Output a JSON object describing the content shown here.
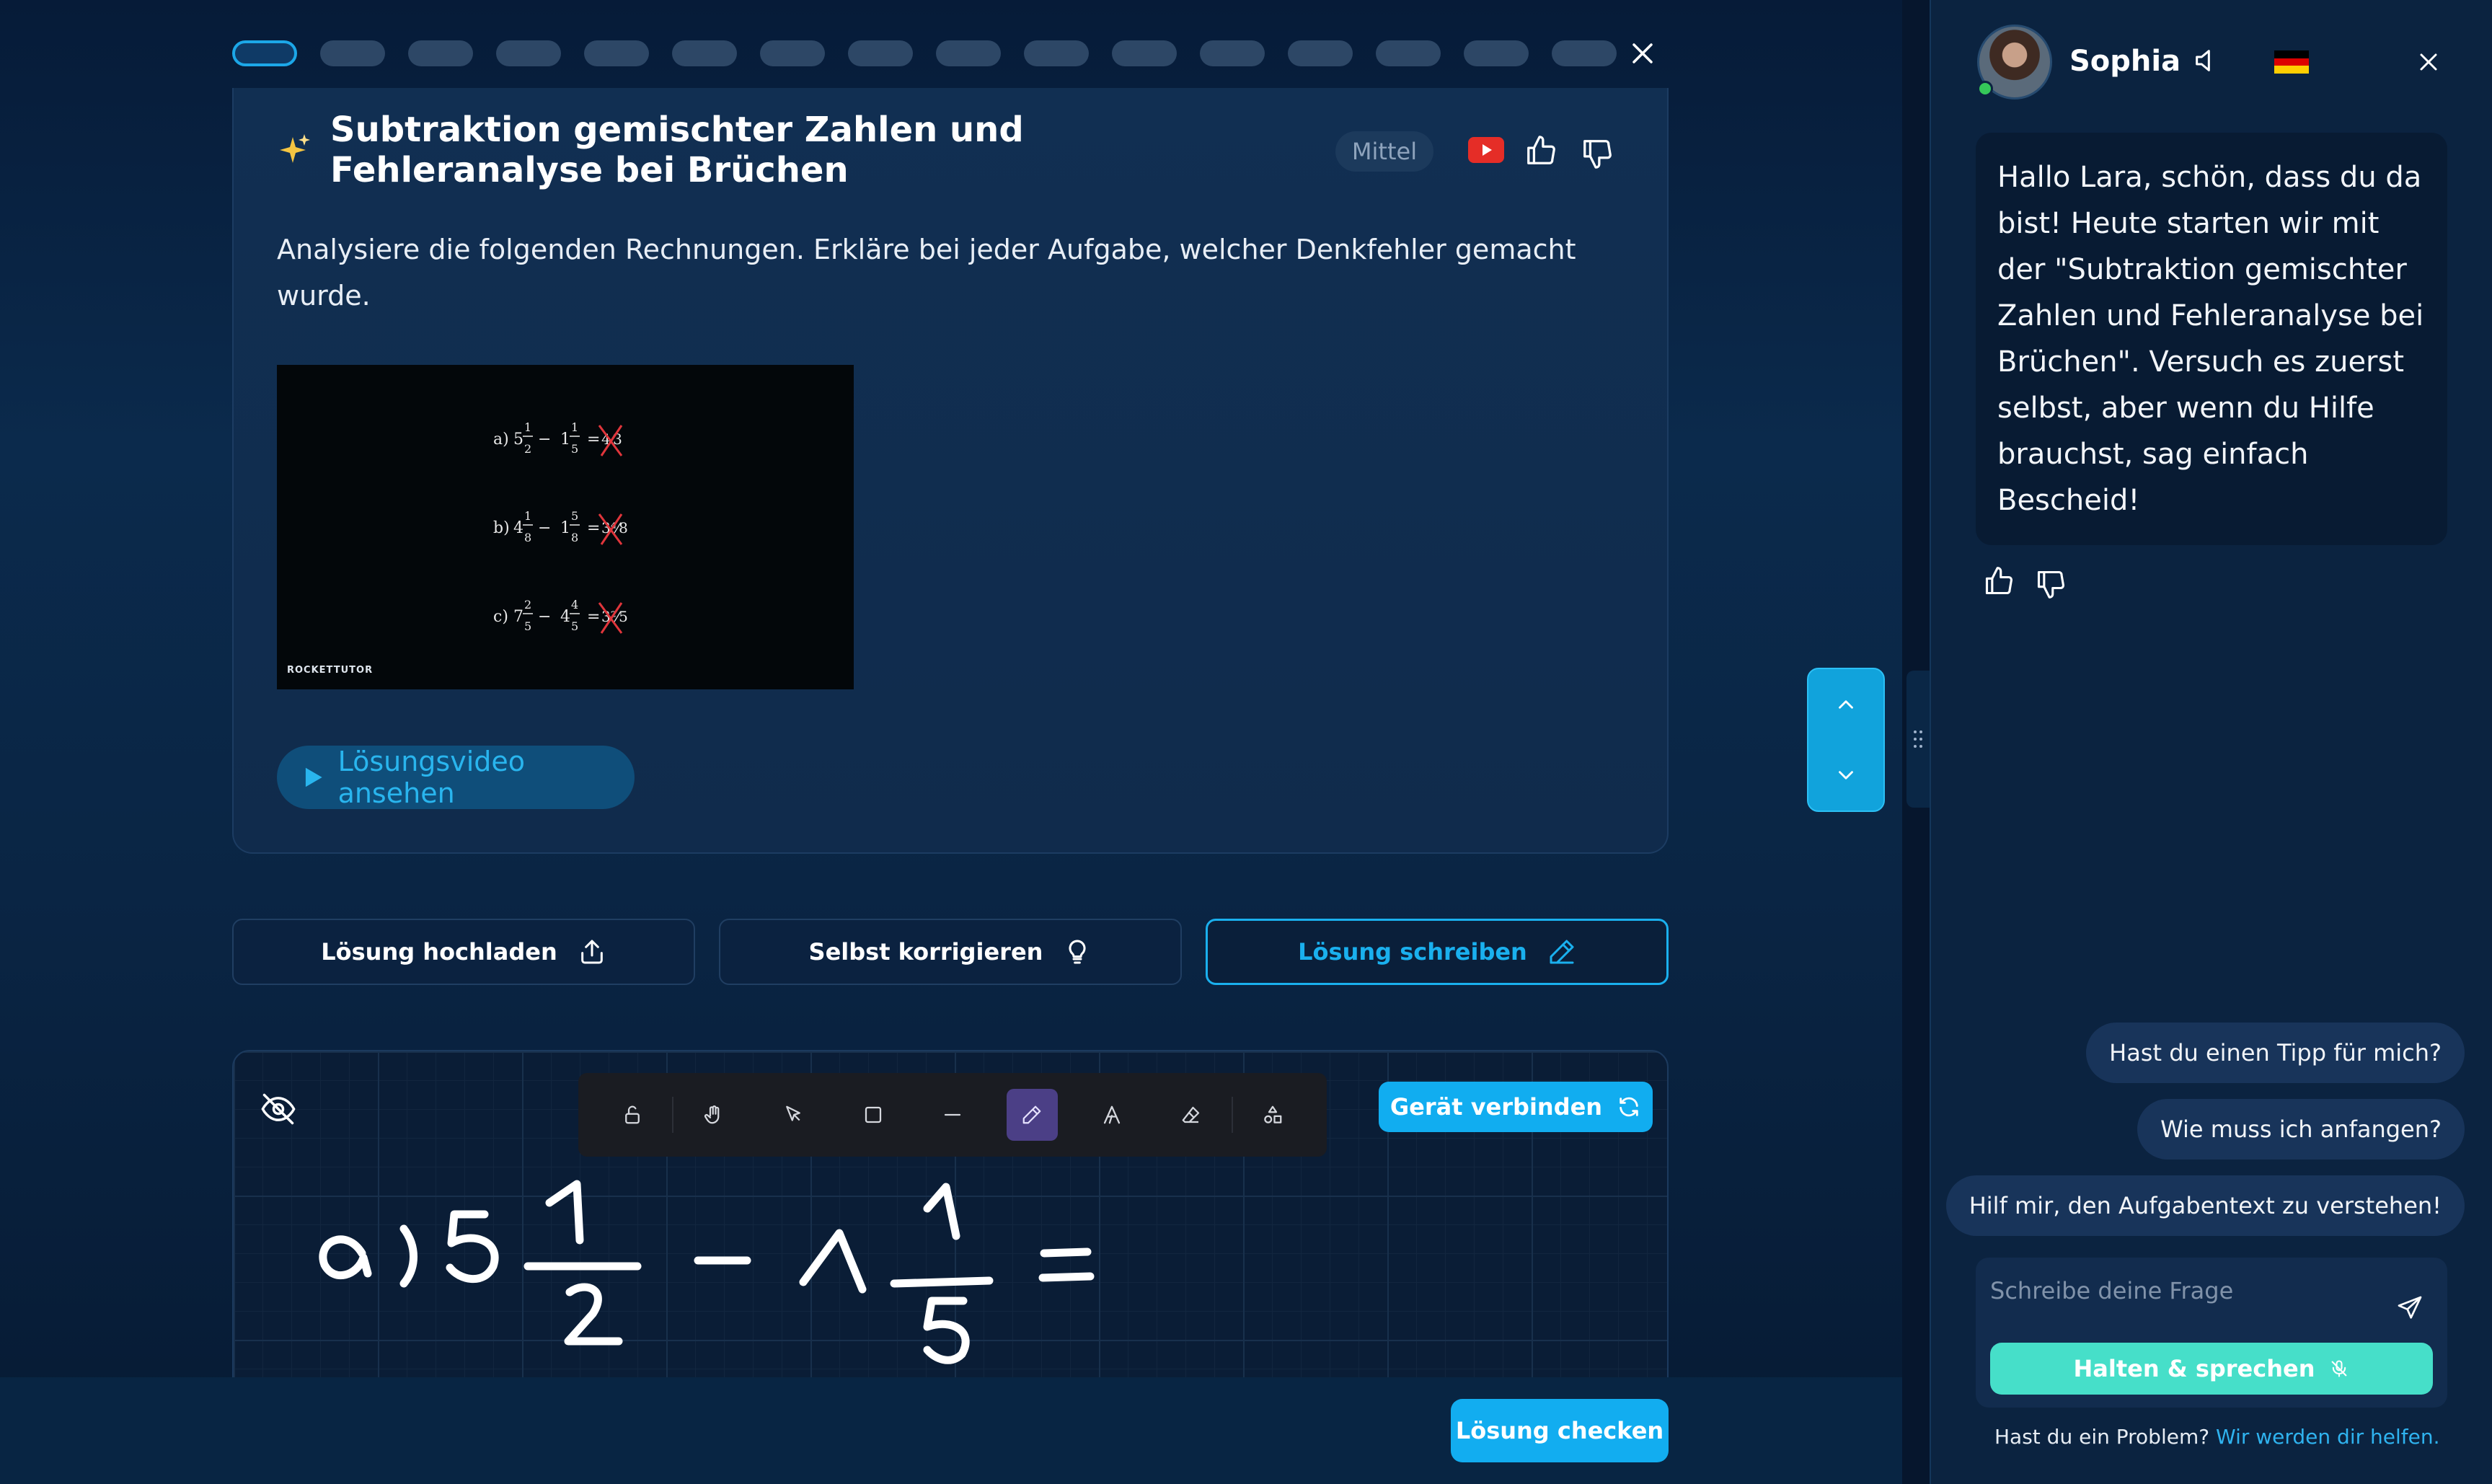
{
  "progress": {
    "total_segments": 16,
    "active_index": 0
  },
  "task": {
    "title": "Subtraktion gemischter Zahlen und Fehleranalyse bei Brüchen",
    "difficulty": "Mittel",
    "description": "Analysiere die folgenden Rechnungen. Erkläre bei jeder Aufgabe, welcher Denkfehler gemacht wurde.",
    "image": {
      "logo": "ROCKETTUTOR",
      "exercises": [
        {
          "label": "a)",
          "whole1": "5",
          "num1": "1",
          "den1": "2",
          "whole2": "1",
          "num2": "1",
          "den2": "5",
          "wrong_answer": "4⁄3"
        },
        {
          "label": "b)",
          "whole1": "4",
          "num1": "1",
          "den1": "8",
          "whole2": "1",
          "num2": "5",
          "den2": "8",
          "wrong_answer": "3⁴⁄8"
        },
        {
          "label": "c)",
          "whole1": "7",
          "num1": "2",
          "den1": "5",
          "whole2": "4",
          "num2": "4",
          "den2": "5",
          "wrong_answer": "3²⁄5"
        }
      ]
    },
    "video_button_label": "Lösungsvideo ansehen"
  },
  "actions": {
    "upload_label": "Lösung hochladen",
    "self_correct_label": "Selbst korrigieren",
    "write_label": "Lösung schreiben",
    "selected": "write"
  },
  "whiteboard": {
    "connect_device_label": "Gerät verbinden",
    "tools": [
      "lock-icon",
      "hand-icon",
      "pointer-icon",
      "rectangle-icon",
      "line-icon",
      "pencil-icon",
      "text-icon",
      "eraser-icon",
      "shapes-icon"
    ],
    "active_tool": "pencil-icon"
  },
  "footer": {
    "check_label": "Lösung checken"
  },
  "colors": {
    "accent": "#12adf0",
    "speak": "#46dfc9",
    "active_tool": "#4b3f86",
    "background": "#0b2340"
  },
  "tutor": {
    "name": "Sophia",
    "language_flag": "de-flag-icon",
    "greeting": "Hallo Lara, schön, dass du da bist! Heute starten wir mit der \"Subtraktion gemischter Zahlen und Fehleranalyse bei Brüchen\". Versuch es zuerst selbst, aber wenn du Hilfe brauchst, sag einfach Bescheid!",
    "suggestions": [
      "Hast du einen Tipp für mich?",
      "Wie muss ich anfangen?",
      "Hilf mir, den Aufgabentext zu verstehen!"
    ],
    "input_placeholder": "Schreibe deine Frage",
    "speak_label": "Halten & sprechen",
    "help_text": "Hast du ein Problem?",
    "help_link": "Wir werden dir helfen."
  }
}
